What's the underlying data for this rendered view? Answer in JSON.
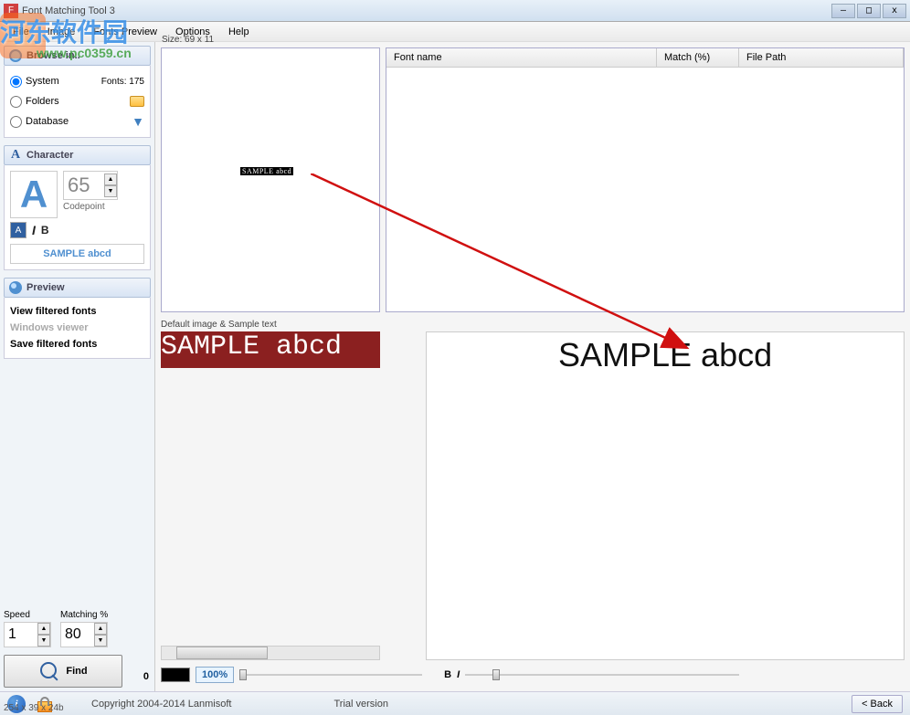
{
  "titlebar": {
    "title": "Font Matching Tool 3"
  },
  "menu": {
    "file": "File",
    "image": "Image",
    "fonts_preview": "Fonts Preview",
    "options": "Options",
    "help": "Help"
  },
  "sidebar": {
    "browse": {
      "header": "Browse in..",
      "system": "System",
      "fonts_count": "Fonts: 175",
      "folders": "Folders",
      "database": "Database"
    },
    "character": {
      "header": "Character",
      "glyph": "A",
      "codepoint": "65",
      "codepoint_label": "Codepoint",
      "sample": "SAMPLE abcd"
    },
    "preview": {
      "header": "Preview",
      "view_filtered": "View filtered fonts",
      "windows_viewer": "Windows viewer",
      "save_filtered": "Save filtered fonts"
    },
    "speed_label": "Speed",
    "matching_label": "Matching %",
    "speed_value": "1",
    "matching_value": "80",
    "find": "Find",
    "find_count": "0"
  },
  "image_area": {
    "size_label": "Size: 69 x 11",
    "sample_text": "SAMPLE abcd"
  },
  "results": {
    "col_fontname": "Font name",
    "col_match": "Match (%)",
    "col_filepath": "File Path"
  },
  "bottom": {
    "default_label": "Default image & Sample text",
    "sample_left": "SAMPLE abcd",
    "sample_right": "SAMPLE abcd",
    "zoom": "100%",
    "bold": "B",
    "italic": "I"
  },
  "statusbar": {
    "copyright": "Copyright 2004-2014 Lanmisoft",
    "trial": "Trial version",
    "back": "< Back",
    "imgsize": "254 x 39 x 24b"
  },
  "watermark": {
    "text1": "河东软件园",
    "url": "www.pc0359.cn"
  }
}
